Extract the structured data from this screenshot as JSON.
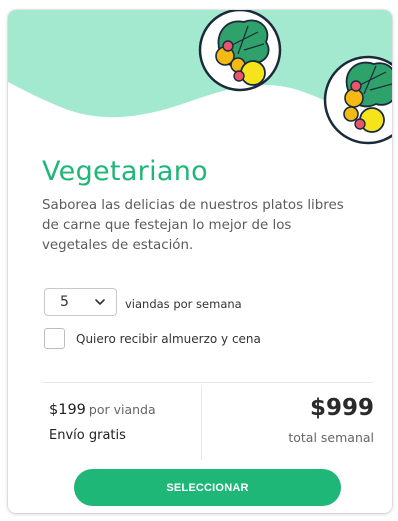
{
  "plan": {
    "title": "Vegetariano",
    "description": "Saborea las delicias de nuestros platos libres de carne que festejan lo mejor de los vegetales de estación."
  },
  "meals_select": {
    "value": "5",
    "suffix_label": "viandas por semana"
  },
  "checkbox": {
    "checked": false,
    "label": "Quiero recibir almuerzo y cena"
  },
  "pricing": {
    "per_meal_amount": "$199",
    "per_meal_unit": "por vianda",
    "shipping": "Envío gratis",
    "total_amount": "$999",
    "total_label": "total semanal"
  },
  "action": {
    "select_label": "SELECCIONAR"
  },
  "icons": [
    "salad-bowl-icon",
    "salad-bowl-icon",
    "chevron-down-icon"
  ],
  "colors": {
    "accent": "#1fb777",
    "wave": "#a3e9d0",
    "plate_border": "#1a2a3a",
    "text_dark": "#222222",
    "text_muted": "#5b5b5b"
  }
}
